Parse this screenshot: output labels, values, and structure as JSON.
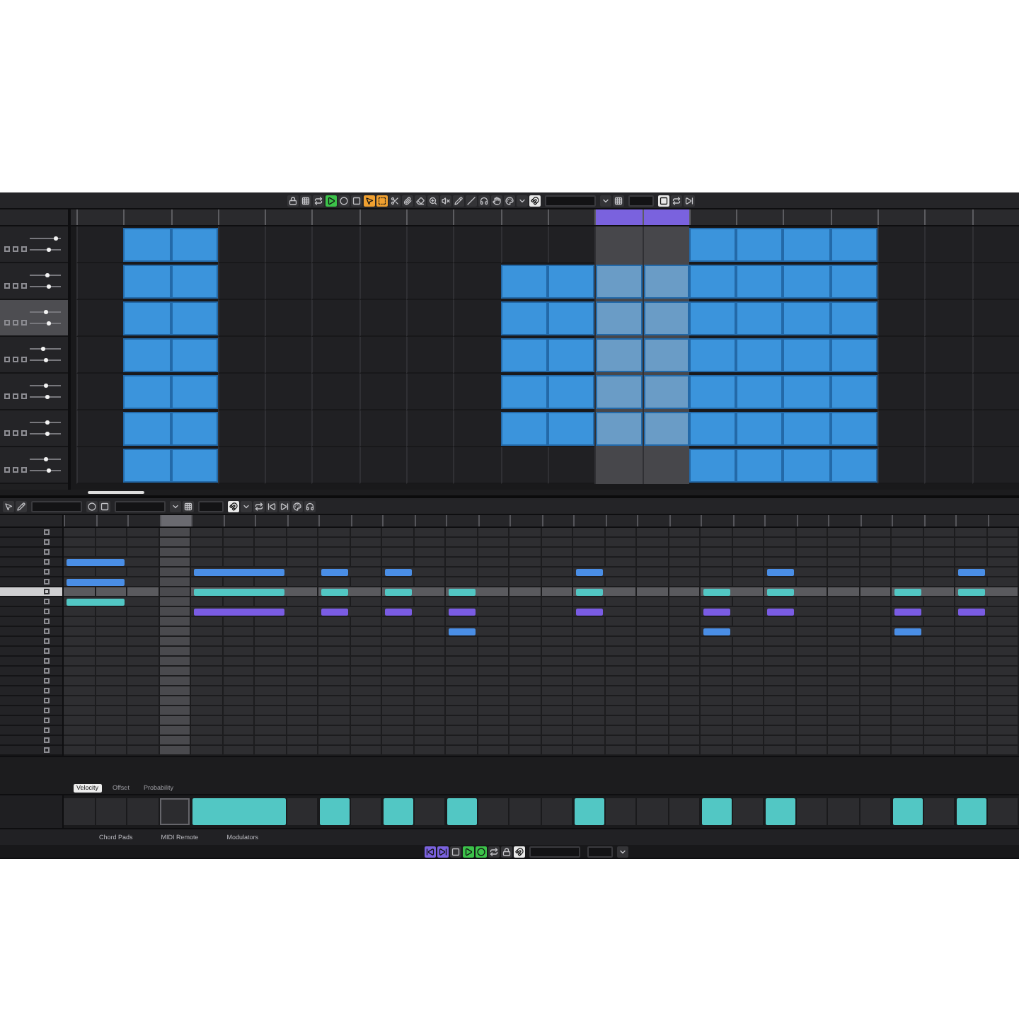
{
  "toolbar": {
    "buttons": [
      {
        "kind": "lock",
        "on": false
      },
      {
        "kind": "grid",
        "on": false
      },
      {
        "kind": "cycle",
        "on": false
      },
      {
        "kind": "play",
        "on": true,
        "color": "#3cc24a"
      },
      {
        "kind": "record",
        "on": false
      },
      {
        "kind": "stop",
        "on": false
      },
      {
        "kind": "pointer",
        "on": true,
        "color": "#f0a030"
      },
      {
        "kind": "range",
        "on": true,
        "color": "#f0a030"
      },
      {
        "kind": "split",
        "on": false
      },
      {
        "kind": "glue",
        "on": false
      },
      {
        "kind": "erase",
        "on": false
      },
      {
        "kind": "zoom",
        "on": false
      },
      {
        "kind": "mute",
        "on": false
      },
      {
        "kind": "draw",
        "on": false
      },
      {
        "kind": "line",
        "on": false
      },
      {
        "kind": "listen",
        "on": false
      },
      {
        "kind": "hand",
        "on": false
      },
      {
        "kind": "color",
        "on": false
      },
      {
        "kind": "menu",
        "on": false
      },
      {
        "kind": "snap",
        "on": true,
        "color": "#e8e8e8"
      },
      {
        "kind": "wide-field"
      },
      {
        "kind": "menu",
        "on": false
      },
      {
        "kind": "grid",
        "on": false
      },
      {
        "kind": "field"
      },
      {
        "kind": "stop",
        "on": true,
        "color": "#e8e8e8"
      },
      {
        "kind": "cycle",
        "on": false
      },
      {
        "kind": "forward",
        "on": false
      }
    ]
  },
  "timeline": {
    "bars": [
      {
        "cycle": false
      },
      {
        "cycle": false
      },
      {
        "cycle": false
      },
      {
        "cycle": false
      },
      {
        "cycle": false
      },
      {
        "cycle": false
      },
      {
        "cycle": false
      },
      {
        "cycle": false
      },
      {
        "cycle": false
      },
      {
        "cycle": false
      },
      {
        "cycle": false
      },
      {
        "cycle": true
      },
      {
        "cycle": true
      },
      {
        "cycle": false
      },
      {
        "cycle": false
      },
      {
        "cycle": false
      },
      {
        "cycle": false
      },
      {
        "cycle": false
      },
      {
        "cycle": false
      },
      {
        "cycle": false
      }
    ]
  },
  "tracks": [
    {
      "selected": false,
      "volume": {
        "level": 0.9
      },
      "pan": {
        "level": 0.65
      },
      "clips": [
        false,
        true,
        true,
        false,
        false,
        false,
        false,
        false,
        false,
        false,
        false,
        false,
        false,
        true,
        true,
        true,
        true,
        false,
        false,
        false
      ]
    },
    {
      "selected": false,
      "volume": {
        "level": 0.6
      },
      "pan": {
        "level": 0.65
      },
      "clips": [
        false,
        true,
        true,
        false,
        false,
        false,
        false,
        false,
        false,
        true,
        true,
        true,
        true,
        true,
        true,
        true,
        true,
        false,
        false,
        false
      ]
    },
    {
      "selected": true,
      "volume": {
        "level": 0.55
      },
      "pan": {
        "level": 0.65
      },
      "clips": [
        false,
        true,
        true,
        false,
        false,
        false,
        false,
        false,
        false,
        true,
        true,
        true,
        true,
        true,
        true,
        true,
        true,
        false,
        false,
        false
      ]
    },
    {
      "selected": false,
      "volume": {
        "level": 0.4
      },
      "pan": {
        "level": 0.5
      },
      "clips": [
        false,
        true,
        true,
        false,
        false,
        false,
        false,
        false,
        false,
        true,
        true,
        true,
        true,
        true,
        true,
        true,
        true,
        false,
        false,
        false
      ]
    },
    {
      "selected": false,
      "volume": {
        "level": 0.55
      },
      "pan": {
        "level": 0.6
      },
      "clips": [
        false,
        true,
        true,
        false,
        false,
        false,
        false,
        false,
        false,
        true,
        true,
        true,
        true,
        true,
        true,
        true,
        true,
        false,
        false,
        false
      ]
    },
    {
      "selected": false,
      "volume": {
        "level": 0.6
      },
      "pan": {
        "level": 0.6
      },
      "clips": [
        false,
        true,
        true,
        false,
        false,
        false,
        false,
        false,
        false,
        true,
        true,
        true,
        true,
        true,
        true,
        true,
        true,
        false,
        false,
        false
      ]
    },
    {
      "selected": false,
      "volume": {
        "level": 0.5
      },
      "pan": {
        "level": 0.65
      },
      "clips": [
        false,
        true,
        true,
        false,
        false,
        false,
        false,
        false,
        false,
        false,
        false,
        false,
        false,
        true,
        true,
        true,
        true,
        false,
        false,
        false
      ]
    }
  ],
  "editor": {
    "toolbar": {
      "buttons": [
        {
          "kind": "pointer",
          "on": false
        },
        {
          "kind": "draw",
          "on": false
        },
        {
          "kind": "wide-field"
        },
        {
          "kind": "record",
          "on": false
        },
        {
          "kind": "stop",
          "on": false
        },
        {
          "kind": "wide-field"
        },
        {
          "kind": "menu",
          "on": false
        },
        {
          "kind": "grid",
          "on": false
        },
        {
          "kind": "field"
        },
        {
          "kind": "snap",
          "on": true,
          "color": "#e8e8e8"
        },
        {
          "kind": "menu",
          "on": false
        },
        {
          "kind": "cycle",
          "on": false
        },
        {
          "kind": "rewind",
          "on": false
        },
        {
          "kind": "forward",
          "on": false
        },
        {
          "kind": "color",
          "on": false
        },
        {
          "kind": "listen",
          "on": false
        }
      ]
    },
    "columns": [
      {
        "selected": false
      },
      {
        "selected": false
      },
      {
        "selected": false
      },
      {
        "selected": true
      },
      {
        "selected": false
      },
      {
        "selected": false
      },
      {
        "selected": false
      },
      {
        "selected": false
      },
      {
        "selected": false
      },
      {
        "selected": false
      },
      {
        "selected": false
      },
      {
        "selected": false
      },
      {
        "selected": false
      },
      {
        "selected": false
      },
      {
        "selected": false
      },
      {
        "selected": false
      },
      {
        "selected": false
      },
      {
        "selected": false
      },
      {
        "selected": false
      },
      {
        "selected": false
      },
      {
        "selected": false
      },
      {
        "selected": false
      },
      {
        "selected": false
      },
      {
        "selected": false
      },
      {
        "selected": false
      },
      {
        "selected": false
      },
      {
        "selected": false
      },
      {
        "selected": false
      },
      {
        "selected": false
      },
      {
        "selected": false
      }
    ],
    "lanes": [
      {
        "selected": false
      },
      {
        "selected": false
      },
      {
        "selected": false
      },
      {
        "selected": false,
        "color": "#4a8ee6",
        "steps": [
          true,
          true,
          false,
          false,
          false,
          false,
          false,
          false,
          false,
          false,
          false,
          false,
          false,
          false,
          false,
          false,
          false,
          false,
          false,
          false,
          false,
          false,
          false,
          false,
          false,
          false,
          false,
          false,
          false,
          false
        ]
      },
      {
        "selected": false,
        "color": "#4a8ee6",
        "steps": [
          false,
          false,
          false,
          false,
          true,
          true,
          true,
          false,
          true,
          false,
          true,
          false,
          false,
          false,
          false,
          false,
          true,
          false,
          false,
          false,
          false,
          false,
          true,
          false,
          false,
          false,
          false,
          false,
          true,
          false
        ]
      },
      {
        "selected": false,
        "color": "#4a8ee6",
        "steps": [
          true,
          true,
          false,
          false,
          false,
          false,
          false,
          false,
          false,
          false,
          false,
          false,
          false,
          false,
          false,
          false,
          false,
          false,
          false,
          false,
          false,
          false,
          false,
          false,
          false,
          false,
          false,
          false,
          false,
          false
        ]
      },
      {
        "selected": true,
        "color": "#52c7c4",
        "steps": [
          false,
          false,
          false,
          false,
          true,
          true,
          true,
          false,
          true,
          false,
          true,
          false,
          true,
          false,
          false,
          false,
          true,
          false,
          false,
          false,
          true,
          false,
          true,
          false,
          false,
          false,
          true,
          false,
          true,
          false
        ]
      },
      {
        "selected": false,
        "color": "#52c7c4",
        "steps": [
          true,
          true,
          false,
          false,
          false,
          false,
          false,
          false,
          false,
          false,
          false,
          false,
          false,
          false,
          false,
          false,
          false,
          false,
          false,
          false,
          false,
          false,
          false,
          false,
          false,
          false,
          false,
          false,
          false,
          false
        ]
      },
      {
        "selected": false,
        "color": "#7a5ce4",
        "steps": [
          false,
          false,
          false,
          false,
          true,
          true,
          true,
          false,
          true,
          false,
          true,
          false,
          true,
          false,
          false,
          false,
          true,
          false,
          false,
          false,
          true,
          false,
          true,
          false,
          false,
          false,
          true,
          false,
          true,
          false
        ]
      },
      {
        "selected": false
      },
      {
        "selected": false,
        "color": "#4a8ee6",
        "steps": [
          false,
          false,
          false,
          false,
          false,
          false,
          false,
          false,
          false,
          false,
          false,
          false,
          true,
          false,
          false,
          false,
          false,
          false,
          false,
          false,
          true,
          false,
          false,
          false,
          false,
          false,
          true,
          false,
          false,
          false
        ]
      },
      {
        "selected": false
      },
      {
        "selected": false
      },
      {
        "selected": false
      },
      {
        "selected": false
      },
      {
        "selected": false
      },
      {
        "selected": false
      },
      {
        "selected": false
      },
      {
        "selected": false
      },
      {
        "selected": false
      },
      {
        "selected": false
      },
      {
        "selected": false
      },
      {
        "selected": false
      }
    ],
    "velocity_lane": {
      "tabs": [
        {
          "label": "Velocity",
          "selected": true
        },
        {
          "label": "Offset",
          "selected": false
        },
        {
          "label": "Probability",
          "selected": false
        }
      ]
    }
  },
  "lower_zone": {
    "tabs": [
      {
        "label": "Chord Pads",
        "selected": false
      },
      {
        "label": "MIDI Remote",
        "selected": false
      },
      {
        "label": "Modulators",
        "selected": false
      }
    ]
  },
  "transport": {
    "buttons": [
      {
        "kind": "rewind",
        "on": true,
        "color": "#7a62de"
      },
      {
        "kind": "forward",
        "on": true,
        "color": "#7a62de"
      },
      {
        "kind": "stop",
        "on": false
      },
      {
        "kind": "play",
        "on": true,
        "color": "#3cc24a"
      },
      {
        "kind": "record",
        "on": true,
        "color": "#3cc24a"
      },
      {
        "kind": "cycle",
        "on": false
      },
      {
        "kind": "lock",
        "on": false
      },
      {
        "kind": "snap",
        "on": true,
        "color": "#e8e8e8"
      },
      {
        "kind": "wide-field"
      },
      {
        "kind": "field"
      },
      {
        "kind": "menu",
        "on": false
      }
    ]
  }
}
